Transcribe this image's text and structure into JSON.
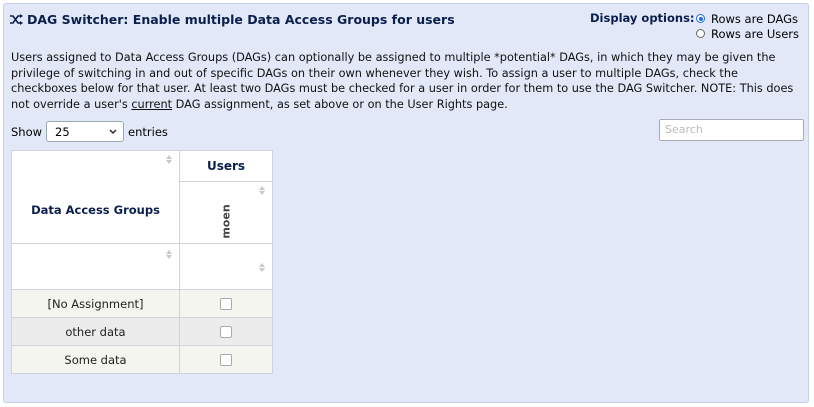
{
  "header": {
    "title": "DAG Switcher: Enable multiple Data Access Groups for users",
    "display_label": "Display options:",
    "options": [
      {
        "label": "Rows are DAGs",
        "selected": true
      },
      {
        "label": "Rows are Users",
        "selected": false
      }
    ]
  },
  "description": {
    "before": "Users assigned to Data Access Groups (DAGs) can optionally be assigned to multiple *potential* DAGs, in which they may be given the privilege of switching in and out of specific DAGs on their own whenever they wish. To assign a user to multiple DAGs, check the checkboxes below for that user. At least two DAGs must be checked for a user in order for them to use the DAG Switcher. NOTE: This does not override a user's ",
    "underlined": "current",
    "after": " DAG assignment, as set above or on the User Rights page."
  },
  "controls": {
    "show_label": "Show",
    "entries_value": "25",
    "entries_label": "entries",
    "search_placeholder": "Search"
  },
  "table": {
    "dag_header": "Data Access Groups",
    "users_header": "Users",
    "user_columns": [
      "moen"
    ],
    "rows": [
      {
        "name": "[No Assignment]",
        "checked": false
      },
      {
        "name": "other data",
        "checked": false
      },
      {
        "name": "Some data",
        "checked": false
      }
    ]
  },
  "icons": {
    "title_icon": "shuffle-icon",
    "sort_icon": "sort-arrows-icon",
    "select_icon": "chevron-down-icon"
  },
  "colors": {
    "panel_bg": "#e2e8f8",
    "title_color": "#0b1f4d",
    "radio_accent": "#1f6fe0"
  }
}
